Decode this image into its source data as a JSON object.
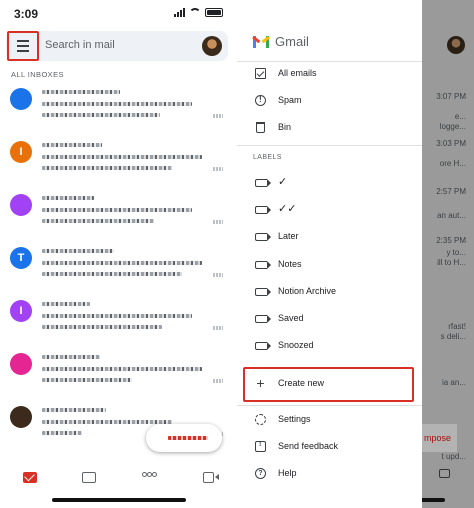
{
  "status_bar": {
    "time": "3:09"
  },
  "search": {
    "placeholder": "Search in mail"
  },
  "inbox": {
    "section_label": "ALL INBOXES"
  },
  "mail_list": {
    "rows": [
      {
        "avatar_color": "#1a73e8",
        "avatar_letter": ""
      },
      {
        "avatar_color": "#e8710a",
        "avatar_letter": "I"
      },
      {
        "avatar_color": "#a142f4",
        "avatar_letter": ""
      },
      {
        "avatar_color": "#1a73e8",
        "avatar_letter": "T"
      },
      {
        "avatar_color": "#a142f4",
        "avatar_letter": "I"
      },
      {
        "avatar_color": "#e52592",
        "avatar_letter": ""
      },
      {
        "avatar_color": "#3c2a1c",
        "avatar_letter": ""
      }
    ]
  },
  "drawer": {
    "app_name": "Gmail",
    "items": [
      {
        "label": "All emails",
        "icon": "all-mail-icon"
      },
      {
        "label": "Spam",
        "icon": "spam-icon"
      },
      {
        "label": "Bin",
        "icon": "bin-icon"
      }
    ],
    "labels_header": "LABELS",
    "labels": [
      {
        "label": "✓"
      },
      {
        "label": "✓✓"
      },
      {
        "label": "Later"
      },
      {
        "label": "Notes"
      },
      {
        "label": "Notion Archive"
      },
      {
        "label": "Saved"
      },
      {
        "label": "Snoozed"
      }
    ],
    "create_new": "Create new",
    "footer": [
      {
        "label": "Settings",
        "icon": "settings-icon"
      },
      {
        "label": "Send feedback",
        "icon": "feedback-icon"
      },
      {
        "label": "Help",
        "icon": "help-icon"
      }
    ]
  },
  "background": {
    "times": [
      "3:07 PM",
      "3:03 PM",
      "2:57 PM",
      "2:35 PM"
    ],
    "snippets": [
      "e...",
      "logge...",
      "ore H...",
      "an aut...",
      "y to...",
      "ill to H...",
      "rfast!",
      "s deli...",
      "ia an...",
      "t upd..."
    ],
    "compose_label": "mpose"
  },
  "colors": {
    "accent": "#d93025",
    "highlight": "#d93025"
  }
}
